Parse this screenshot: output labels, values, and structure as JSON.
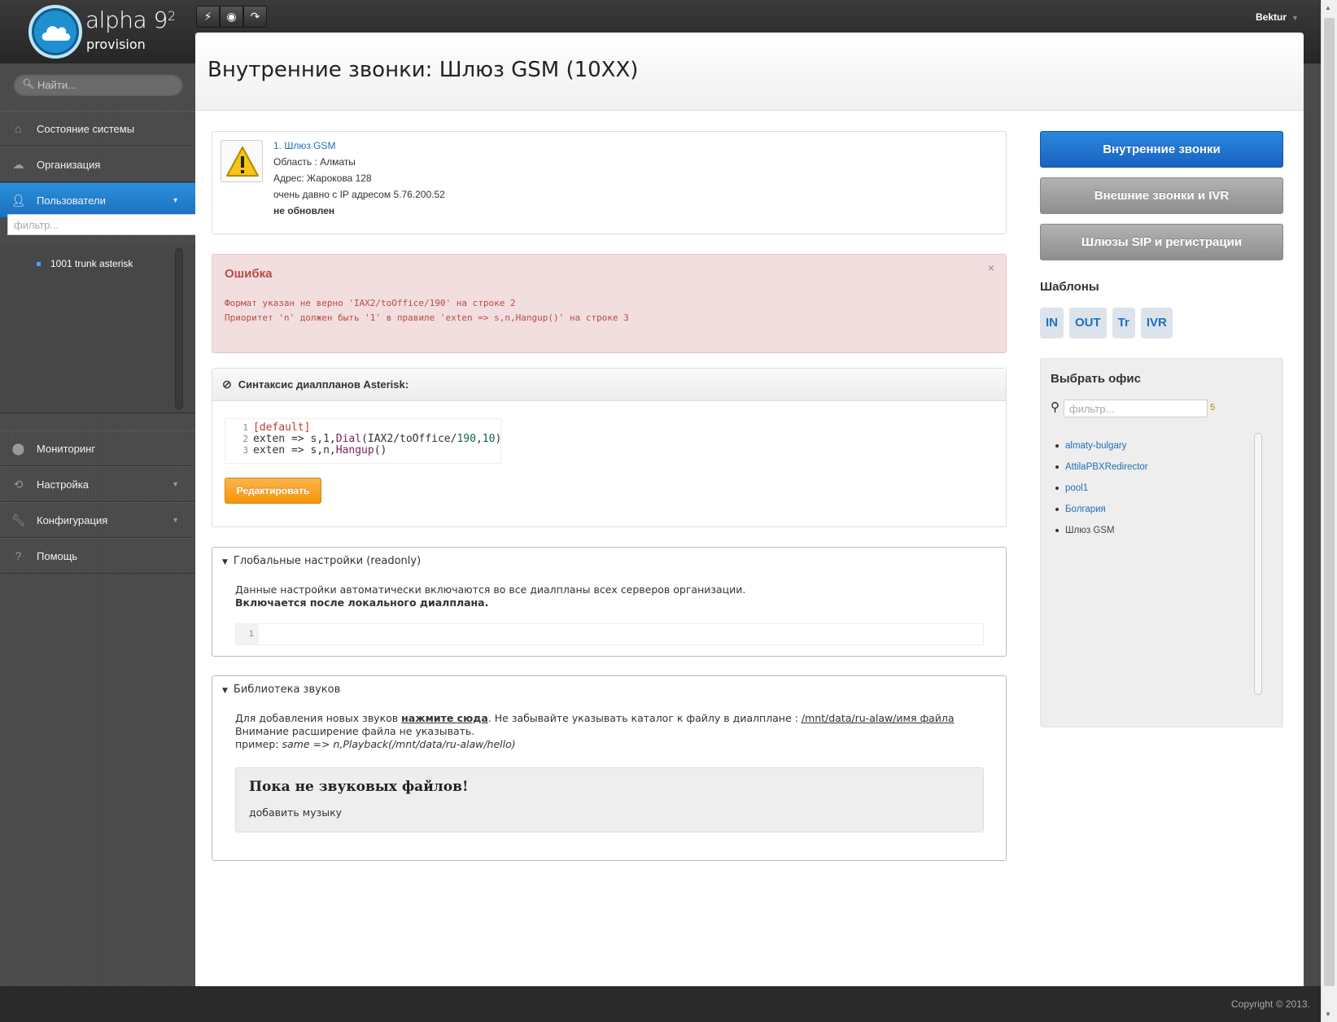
{
  "brand": {
    "name": "alpha 9",
    "superscript": "2",
    "sub": "provision"
  },
  "header": {
    "user": "Bektur"
  },
  "sidebar": {
    "search_placeholder": "Найти...",
    "items_top": [
      {
        "label": "Состояние системы",
        "icon": "home-icon"
      },
      {
        "label": "Организация",
        "icon": "cloud-icon"
      },
      {
        "label": "Пользователи",
        "icon": "user-icon",
        "active": true
      }
    ],
    "filter_placeholder": "фильтр...",
    "tree": [
      {
        "label": "1001 trunk asterisk"
      }
    ],
    "items_bottom": [
      {
        "label": "Мониторинг",
        "icon": "map-marker-icon"
      },
      {
        "label": "Настройка",
        "icon": "refresh-icon"
      },
      {
        "label": "Конфигурация",
        "icon": "wrench-icon"
      },
      {
        "label": "Помощь",
        "icon": "question-icon"
      }
    ]
  },
  "page": {
    "title": "Внутренние звонки: Шлюз GSM (10XX)"
  },
  "server": {
    "name": "1. Шлюз GSM",
    "region": "Область : Алматы",
    "address": "Адрес: Жарокова 128",
    "last_seen": "очень давно с IP адресом 5.76.200.52",
    "status": "не обновлен"
  },
  "error": {
    "title": "Ошибка",
    "close": "×",
    "lines": [
      "Формат указан не верно 'IAX2/toOffice/190' на строке 2",
      "Приоритет 'n' должен быть '1' в правиле 'exten => s,n,Hangup()' на строке 3"
    ]
  },
  "syntax": {
    "title": "Синтаксис диалпланов Asterisk:",
    "line_numbers": [
      "1",
      "2",
      "3"
    ],
    "edit_button": "Редактировать"
  },
  "global_settings": {
    "title": "Глобальные настройки (readonly)",
    "text": "Данные настройки автоматически включаются во все диалпланы всех серверов организации.",
    "bold": "Включается после локального диалплана.",
    "line_number": "1"
  },
  "sound_library": {
    "title": "Библиотека звуков",
    "text_before": "Для добавления новых звуков ",
    "link": "нажмите сюда",
    "text_middle": ". Не забывайте указывать каталог к файлу в диалплане : ",
    "path": "/mnt/data/ru-alaw/имя файла",
    "text_after": " Внимание расширение файла не указывать.",
    "example_label": "пример: ",
    "example": "same => n,Playback(/mnt/data/ru-alaw/hello)",
    "empty_title": "Пока не звуковых файлов!",
    "empty_link": "добавить музыку"
  },
  "right": {
    "buttons": [
      "Внутренние звонки",
      "Внешние звонки и IVR",
      "Шлюзы SIP и регистрации"
    ],
    "templates_label": "Шаблоны",
    "templates": [
      "IN",
      "OUT",
      "Tr",
      "IVR"
    ],
    "office_title": "Выбрать офис",
    "office_filter_placeholder": "фильтр...",
    "office_count": "5",
    "offices": [
      "almaty-bulgary",
      "AttilaPBXRedirector",
      "pool1",
      "Болгария",
      "Шлюз GSM"
    ]
  },
  "footer": {
    "copyright": "Copyright © 2013."
  }
}
